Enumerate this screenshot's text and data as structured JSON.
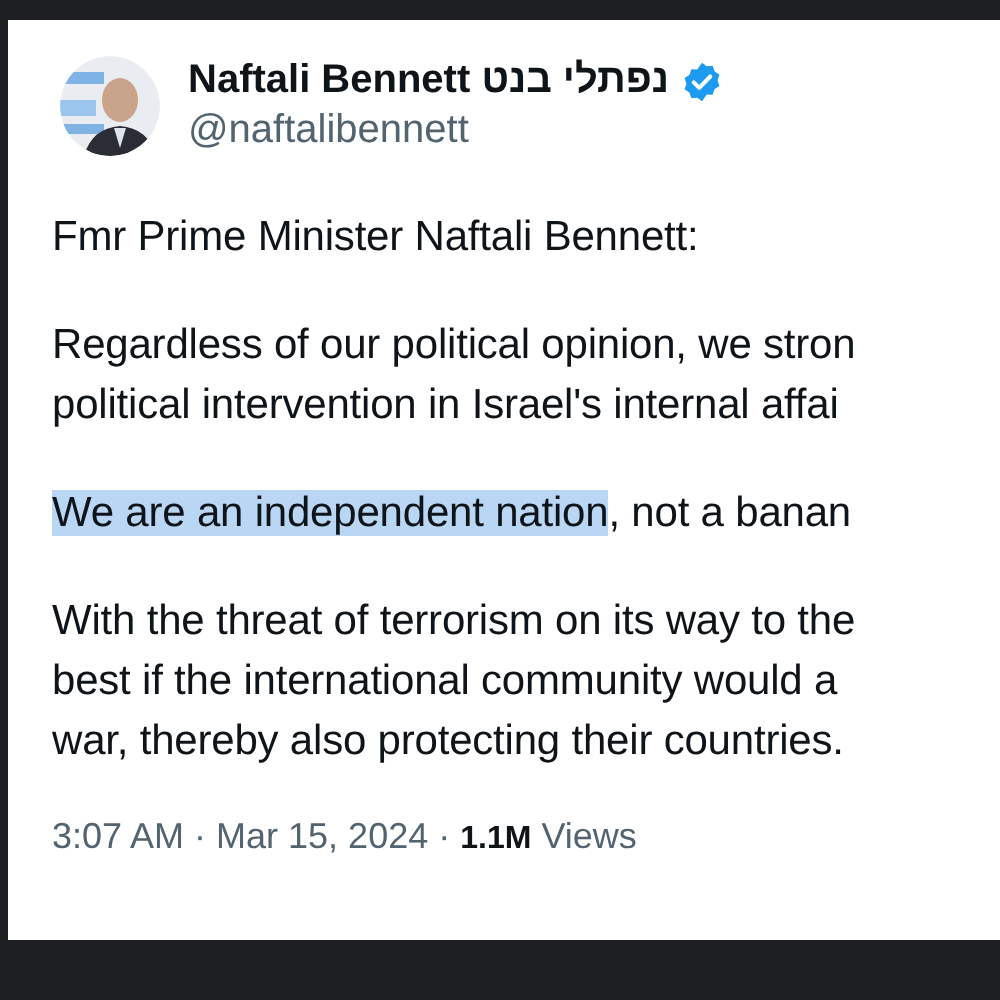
{
  "author": {
    "name": "Naftali Bennett נפתלי בנט",
    "verified": true,
    "handle": "@naftalibennett"
  },
  "paragraphs": [
    {
      "lines": [
        [
          {
            "text": "Fmr Prime Minister Naftali Bennett:",
            "highlighted": false
          }
        ]
      ]
    },
    {
      "lines": [
        [
          {
            "text": "Regardless of our political opinion, we stron",
            "highlighted": false
          }
        ],
        [
          {
            "text": "political intervention in Israel's internal affai",
            "highlighted": false
          }
        ]
      ]
    },
    {
      "lines": [
        [
          {
            "text": "We are an independent nation",
            "highlighted": true
          },
          {
            "text": ", not a banan",
            "highlighted": false
          }
        ]
      ]
    },
    {
      "lines": [
        [
          {
            "text": "With the threat of terrorism on its way to the",
            "highlighted": false
          }
        ],
        [
          {
            "text": "best if the international community would a",
            "highlighted": false
          }
        ],
        [
          {
            "text": "war, thereby also protecting their countries.",
            "highlighted": false
          }
        ]
      ]
    }
  ],
  "footer": {
    "time": "3:07 AM · Mar 15, 2024 ·",
    "views_count": "1.1M",
    "views_label": "Views"
  }
}
